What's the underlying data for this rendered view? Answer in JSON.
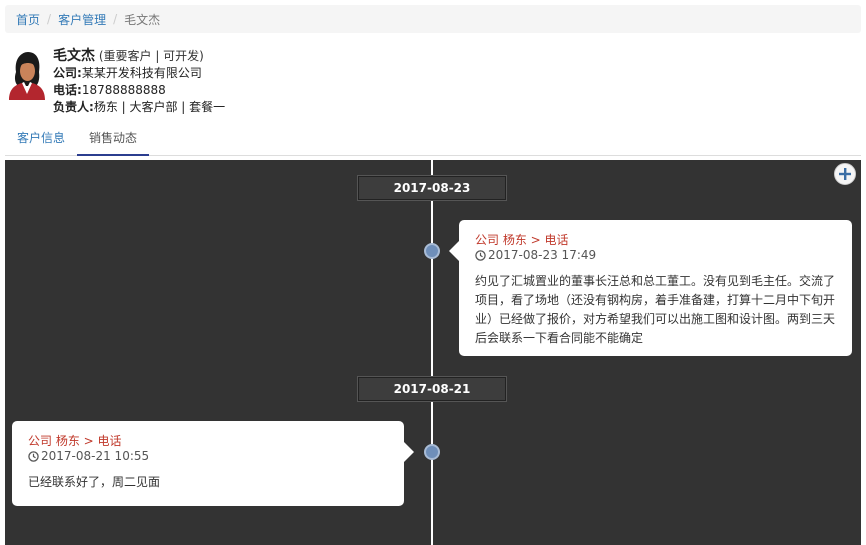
{
  "breadcrumb": {
    "items": [
      "首页",
      "客户管理"
    ],
    "current": "毛文杰"
  },
  "profile": {
    "name": "毛文杰",
    "tags": "(重要客户 | 可开发)",
    "company_label": "公司:",
    "company": "某某开发科技有限公司",
    "phone_label": "电话:",
    "phone": "18788888888",
    "owner_label": "负责人:",
    "owner": "杨东 | 大客户部 | 套餐一"
  },
  "tabs": [
    {
      "label": "客户信息",
      "active": false
    },
    {
      "label": "销售动态",
      "active": true
    }
  ],
  "timeline": {
    "entries": [
      {
        "date": "2017-08-23",
        "side": "right",
        "head": "公司 杨东 > 电话",
        "time": "2017-08-23 17:49",
        "body": "约见了汇城置业的董事长汪总和总工董工。没有见到毛主任。交流了项目，看了场地（还没有钢构房，着手准备建，打算十二月中下旬开业）已经做了报价，对方希望我们可以出施工图和设计图。两到三天后会联系一下看合同能不能确定"
      },
      {
        "date": "2017-08-21",
        "side": "left",
        "head": "公司 杨东 > 电话",
        "time": "2017-08-21 10:55",
        "body": "已经联系好了，周二见面"
      }
    ]
  },
  "colors": {
    "accent": "#337ab7",
    "timeline_bg": "#333333",
    "dot": "#6f8fba",
    "head_text": "#c0392b"
  }
}
